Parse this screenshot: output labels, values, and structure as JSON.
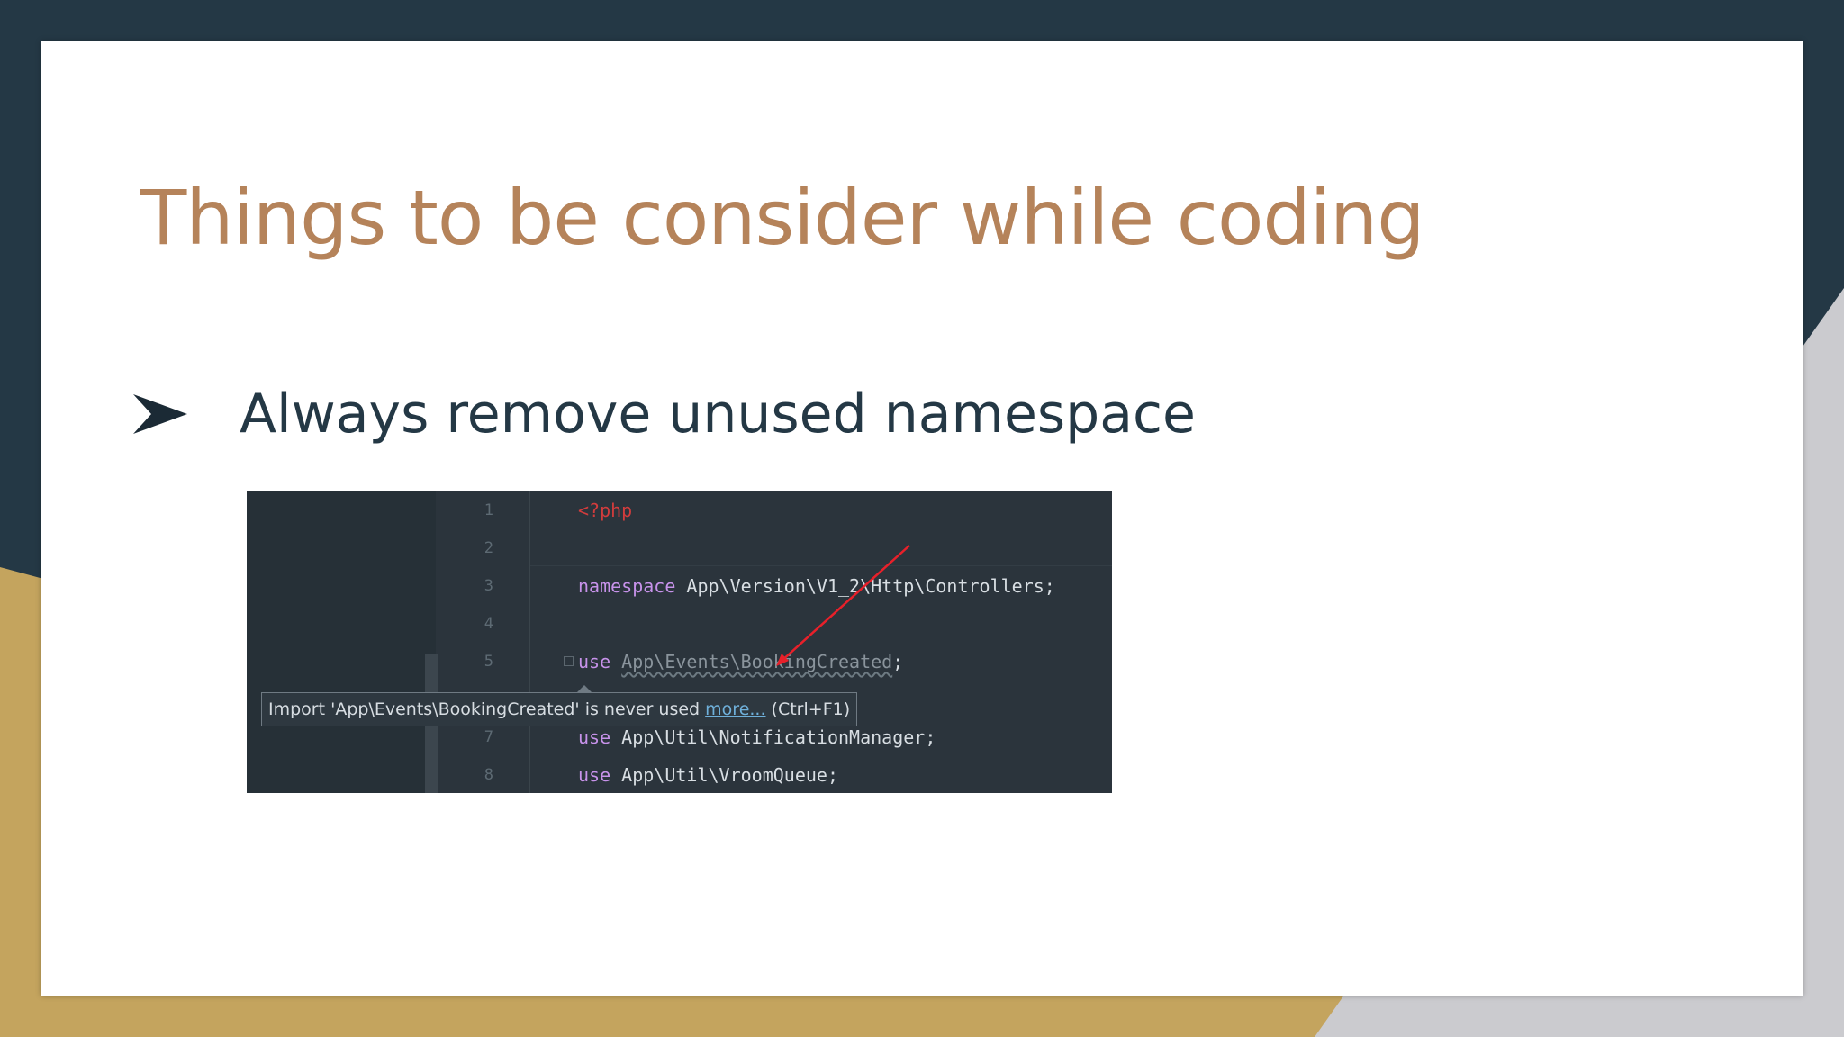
{
  "slide": {
    "title": "Things to be consider while coding",
    "bullet": "Always remove unused namespace",
    "colors": {
      "title": "#b5835a",
      "text": "#243845",
      "background_dark": "#243845",
      "accent_gold": "#c4a45e",
      "accent_grey": "#cbcbcf"
    }
  },
  "code": {
    "lines": [
      {
        "n": "1",
        "parts": [
          {
            "t": "<?php",
            "c": "tag"
          }
        ]
      },
      {
        "n": "2",
        "parts": []
      },
      {
        "n": "3",
        "parts": [
          {
            "t": "namespace",
            "c": "kw"
          },
          {
            "t": " App\\Version\\V1_2\\Http\\Controllers;",
            "c": "text"
          }
        ]
      },
      {
        "n": "4",
        "parts": []
      },
      {
        "n": "5",
        "parts": [
          {
            "t": "use",
            "c": "kw"
          },
          {
            "t": " ",
            "c": "text"
          },
          {
            "t": "App\\Events\\BookingCreated",
            "c": "unused"
          },
          {
            "t": ";",
            "c": "text"
          }
        ]
      },
      {
        "n": "7",
        "parts": [
          {
            "t": "use",
            "c": "kw"
          },
          {
            "t": " App\\Util\\NotificationManager;",
            "c": "text"
          }
        ]
      },
      {
        "n": "8",
        "parts": [
          {
            "t": "use",
            "c": "kw"
          },
          {
            "t": " App\\Util\\VroomQueue;",
            "c": "text"
          }
        ]
      }
    ],
    "tooltip": {
      "message": "Import 'App\\Events\\BookingCreated' is never used ",
      "link": "more...",
      "shortcut": " (Ctrl+F1)"
    },
    "icons": {
      "bullet": "arrowhead-icon",
      "annotation": "red-arrow-icon"
    },
    "colors": {
      "editor_bg": "#2b343c",
      "keyword": "#c792ea",
      "php_tag": "#d23c3c",
      "annotation_arrow": "#e8202a"
    }
  }
}
